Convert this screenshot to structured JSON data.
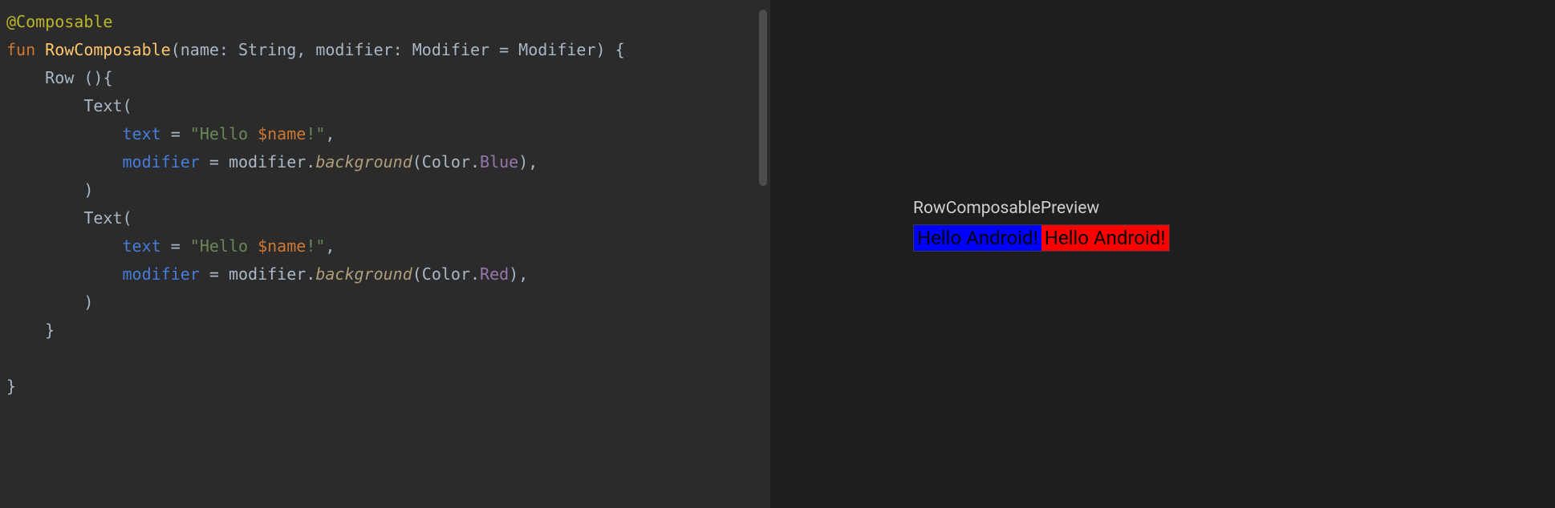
{
  "code": {
    "line1_annotation": "@Composable",
    "line2_fun": "fun",
    "line2_funcname": " RowComposable",
    "line2_paren_open": "(",
    "line2_param1": "name: String, modifier: Modifier = Modifier",
    "line2_paren_close": ") {",
    "line3_indent": "    ",
    "line3_row": "Row ",
    "line3_parens": "()",
    "line3_brace": "{",
    "line4_indent": "        ",
    "line4_text": "Text",
    "line4_paren": "(",
    "line5_indent": "            ",
    "line5_param": "text",
    "line5_eq": " = ",
    "line5_str1": "\"Hello ",
    "line5_var": "$name",
    "line5_str2": "!\"",
    "line5_comma": ",",
    "line6_indent": "            ",
    "line6_param": "modifier",
    "line6_eq": " = modifier.",
    "line6_method": "background",
    "line6_args_open": "(Color.",
    "line6_color": "Blue",
    "line6_close": "),",
    "line7_indent": "        ",
    "line7_close": ")",
    "line8_indent": "        ",
    "line8_text": "Text",
    "line8_paren": "(",
    "line9_indent": "            ",
    "line9_param": "text",
    "line9_eq": " = ",
    "line9_str1": "\"Hello ",
    "line9_var": "$name",
    "line9_str2": "!\"",
    "line9_comma": ",",
    "line10_indent": "            ",
    "line10_param": "modifier",
    "line10_eq": " = modifier.",
    "line10_method": "background",
    "line10_args_open": "(Color.",
    "line10_color": "Red",
    "line10_close": "),",
    "line11_indent": "        ",
    "line11_close": ")",
    "line12_indent": "    ",
    "line12_brace": "}",
    "line14_brace": "}"
  },
  "preview": {
    "label": "RowComposablePreview",
    "text1": "Hello Android!",
    "text2": "Hello Android!"
  }
}
